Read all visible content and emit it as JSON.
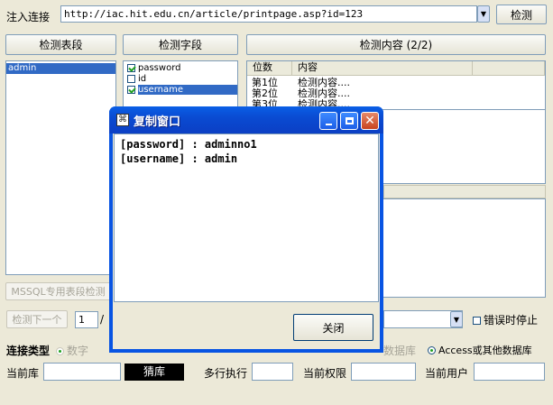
{
  "top": {
    "inject_label": "注入连接",
    "url_value": "http://iac.hit.edu.cn/article/printpage.asp?id=123",
    "detect_button": "检测"
  },
  "panels": {
    "table_header": "检测表段",
    "field_header": "检测字段",
    "content_header": "检测内容 (2/2)"
  },
  "tables": [
    "admin"
  ],
  "fields": [
    {
      "name": "password",
      "checked": true
    },
    {
      "name": "id",
      "checked": false
    },
    {
      "name": "username",
      "checked": true,
      "selected": true
    }
  ],
  "content_grid": {
    "columns": [
      "位数",
      "内容"
    ],
    "rows": [
      {
        "pos": "第1位",
        "content": "检测内容...."
      },
      {
        "pos": "第2位",
        "content": "检测内容...."
      },
      {
        "pos": "第3位",
        "content": "检测内容...."
      }
    ]
  },
  "mssql_button": "MSSQL专用表段检测",
  "paging": {
    "next_button": "检测下一个",
    "page_value": "1",
    "slash": "/"
  },
  "error_stop_label": "错误时停止",
  "connect_type": {
    "label": "连接类型",
    "option_number": "数字",
    "option_other_partial": "数据库",
    "option_access": "Access或其他数据库"
  },
  "bottom": {
    "current_db_label": "当前库",
    "current_db_value": "",
    "black_button": "猜库",
    "multi_exec_label": "多行执行",
    "multi_exec_value": "",
    "current_priv_label": "当前权限",
    "current_priv_value": "",
    "current_user_label": "当前用户",
    "current_user_value": ""
  },
  "dialog": {
    "title": "复制窗口",
    "lines": [
      "[password] : adminno1",
      "[username] : admin"
    ],
    "close_button": "关闭"
  },
  "colors": {
    "window_bg": "#ece9d8",
    "selection": "#316ac5",
    "titlebar": "#0a4bd2",
    "check": "#21a121"
  }
}
